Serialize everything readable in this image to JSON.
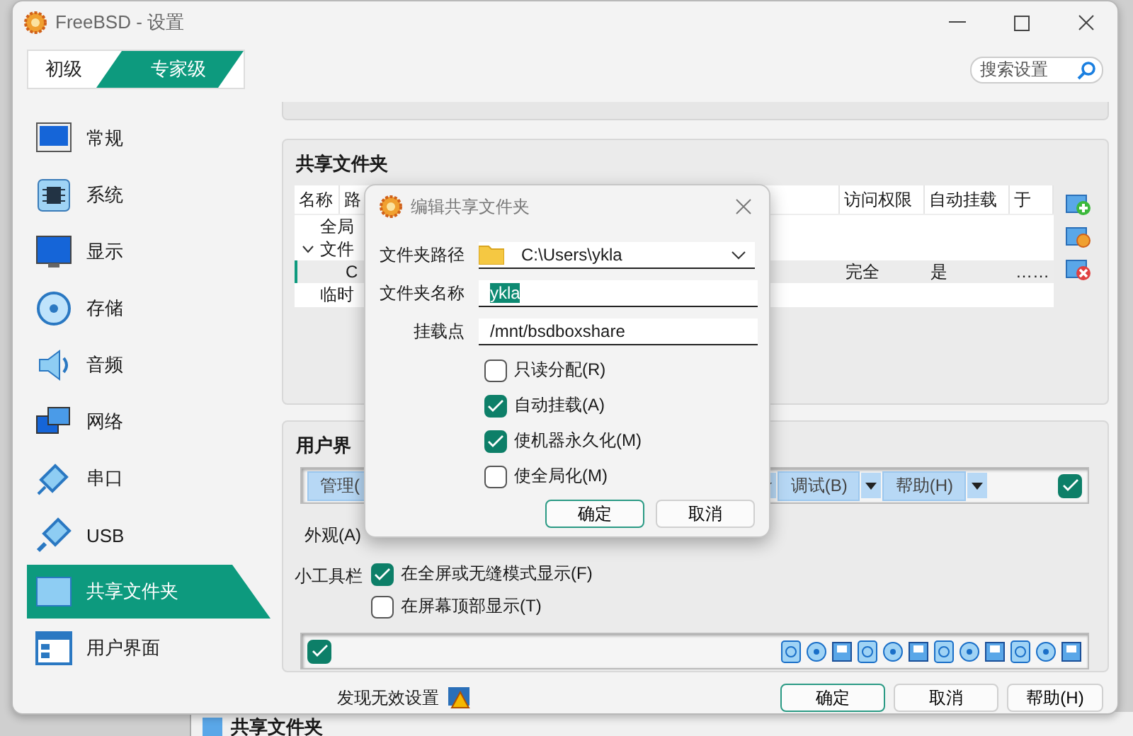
{
  "window": {
    "title": "FreeBSD - 设置"
  },
  "mode_tabs": [
    {
      "label": "初级",
      "selected": false
    },
    {
      "label": "专家级",
      "selected": true
    }
  ],
  "search": {
    "placeholder": "搜索设置"
  },
  "sidebar": {
    "items": [
      {
        "label": "常规",
        "selected": false
      },
      {
        "label": "系统",
        "selected": false
      },
      {
        "label": "显示",
        "selected": false
      },
      {
        "label": "存储",
        "selected": false
      },
      {
        "label": "音频",
        "selected": false
      },
      {
        "label": "网络",
        "selected": false
      },
      {
        "label": "串口",
        "selected": false
      },
      {
        "label": "USB",
        "selected": false
      },
      {
        "label": "共享文件夹",
        "selected": true
      },
      {
        "label": "用户界面",
        "selected": false
      }
    ]
  },
  "shared_folders": {
    "title": "共享文件夹",
    "table": {
      "columns": [
        "名称",
        "路",
        "访问权限",
        "自动挂载",
        "于"
      ],
      "rows": [
        {
          "name": "全局",
          "selected": false
        },
        {
          "name": "文件",
          "expanded": true,
          "selected": false,
          "children": [
            {
              "column_2": "C",
              "access": "完全",
              "auto_mount": "是",
              "column_5": "……",
              "selected": true
            }
          ]
        },
        {
          "name": "临时",
          "selected": false
        }
      ]
    }
  },
  "user_interface": {
    "title": "用户界",
    "menu_bar": {
      "enabled": true,
      "items": [
        {
          "label": "管理("
        },
        {
          "label": "调试(B)"
        },
        {
          "label": "帮助(H)"
        }
      ]
    },
    "appearance_label": "外观(A)",
    "mini_toolbar": {
      "label": "小工具栏",
      "options": [
        {
          "label": "在全屏或无缝模式显示(F)",
          "checked": true
        },
        {
          "label": "在屏幕顶部显示(T)",
          "checked": false
        }
      ]
    },
    "status_bar": {
      "enabled": true
    }
  },
  "footer": {
    "warning": "发现无效设置",
    "buttons": [
      "确定",
      "取消",
      "帮助(H)"
    ]
  },
  "dialog": {
    "title": "编辑共享文件夹",
    "fields": [
      {
        "label": "文件夹路径",
        "kind": "combo",
        "value": "C:\\Users\\ykla"
      },
      {
        "label": "文件夹名称",
        "kind": "text",
        "value": "ykla",
        "highlighted": true
      },
      {
        "label": "挂载点",
        "kind": "text",
        "value": "/mnt/bsdboxshare",
        "highlighted": false
      }
    ],
    "options": [
      {
        "label": "只读分配(R)",
        "checked": false
      },
      {
        "label": "自动挂载(A)",
        "checked": true
      },
      {
        "label": "使机器永久化(M)",
        "checked": true
      },
      {
        "label": "使全局化(M)",
        "checked": false
      }
    ],
    "buttons": [
      "确定",
      "取消"
    ]
  },
  "background_window": {
    "title": "共享文件夹"
  }
}
